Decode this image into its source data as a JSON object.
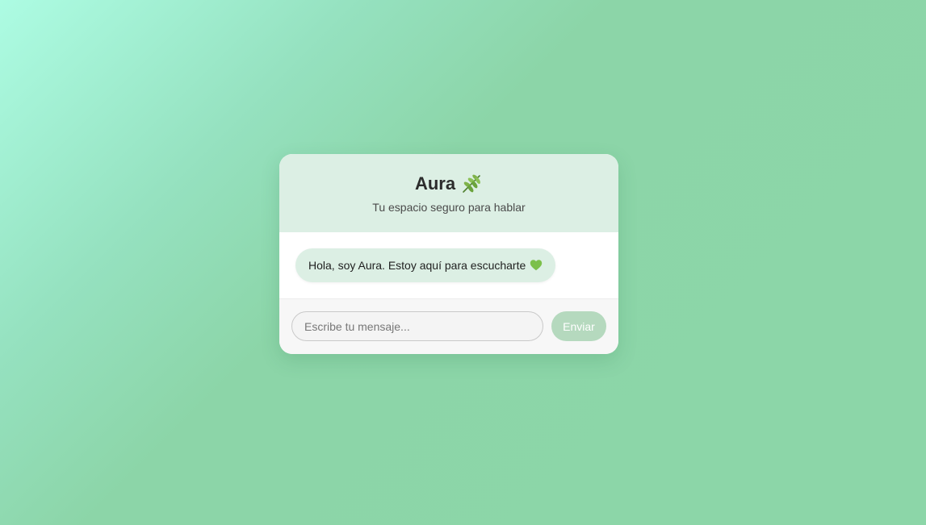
{
  "header": {
    "title": "Aura",
    "title_icon": "leaf-icon",
    "subtitle": "Tu espacio seguro para hablar"
  },
  "messages": [
    {
      "sender": "bot",
      "text": "Hola, soy Aura. Estoy aquí para escucharte",
      "icon": "green-heart-icon"
    }
  ],
  "composer": {
    "input_value": "",
    "placeholder": "Escribe tu mensaje...",
    "send_label": "Enviar"
  },
  "colors": {
    "header_bg": "#dcefe4",
    "bubble_bg": "#dcefe4",
    "send_button": "#b5d9be",
    "background_start": "#adfce3",
    "background_end": "#8cd6a8"
  }
}
